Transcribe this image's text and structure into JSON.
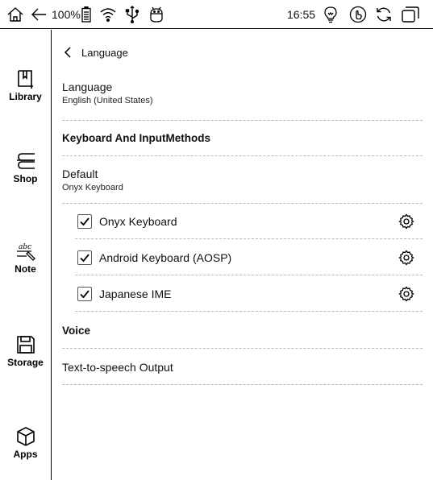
{
  "status_bar": {
    "battery": "100%",
    "time": "16:55",
    "icons": [
      "home-icon",
      "back-arrow-icon",
      "battery-icon",
      "wifi-icon",
      "usb-icon",
      "android-debug-icon",
      "lightbulb-icon",
      "touch-icon",
      "refresh-icon",
      "window-icon"
    ]
  },
  "sidebar": {
    "items": [
      {
        "label": "Library",
        "icon": "book-icon"
      },
      {
        "label": "Shop",
        "icon": "shop-icon"
      },
      {
        "label": "Note",
        "icon": "note-icon"
      },
      {
        "label": "Storage",
        "icon": "storage-icon"
      },
      {
        "label": "Apps",
        "icon": "apps-cube-icon"
      }
    ]
  },
  "header": {
    "back_label": "Language"
  },
  "language": {
    "title": "Language",
    "value": "English (United States)"
  },
  "keyboard_section": {
    "title": "Keyboard And InputMethods"
  },
  "default": {
    "title": "Default",
    "value": "Onyx Keyboard"
  },
  "input_methods": [
    {
      "label": "Onyx Keyboard",
      "checked": true,
      "icon": "gear-icon"
    },
    {
      "label": "Android Keyboard (AOSP)",
      "checked": true,
      "icon": "gear-icon"
    },
    {
      "label": "Japanese IME",
      "checked": true,
      "icon": "gear-icon"
    }
  ],
  "voice_section": {
    "title": "Voice"
  },
  "tts": {
    "title": "Text-to-speech Output"
  }
}
